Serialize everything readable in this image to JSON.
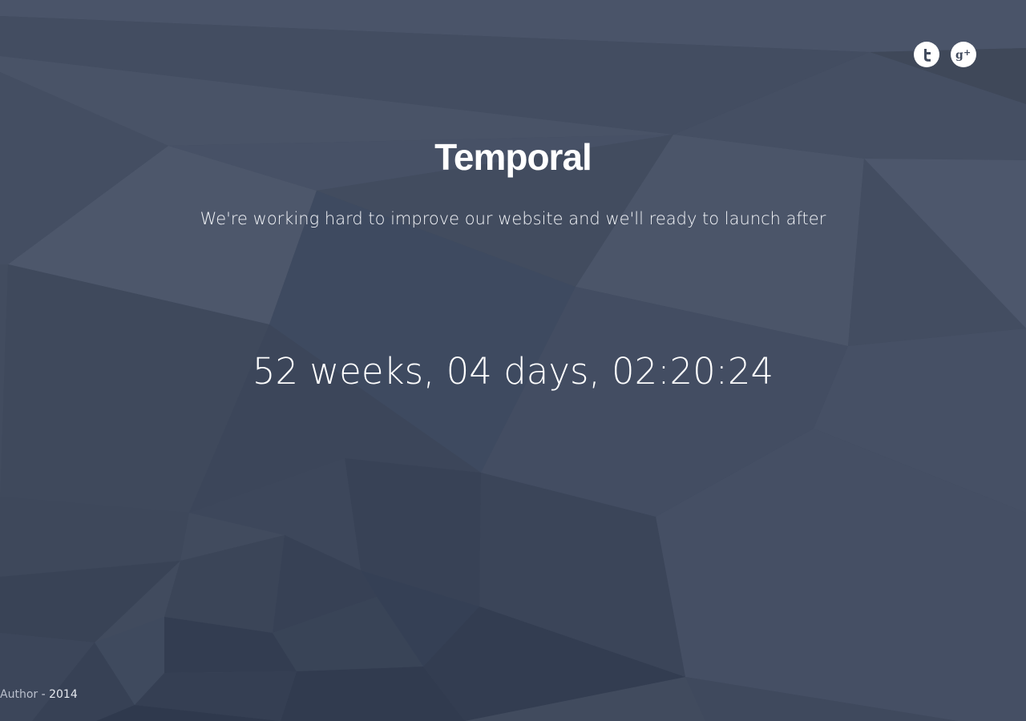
{
  "header": {
    "social": [
      {
        "name": "twitter",
        "icon": "twitter-icon"
      },
      {
        "name": "google-plus",
        "icon": "google-plus-icon"
      }
    ]
  },
  "main": {
    "title": "Temporal",
    "subtitle": "We're working hard to improve our website and we'll ready to launch after",
    "countdown": "52 weeks, 04 days, 02:20:24"
  },
  "footer": {
    "author_link": "Author",
    "separator": " - ",
    "year": "2014"
  },
  "colors": {
    "background": "#414b5e",
    "text": "#ffffff"
  }
}
